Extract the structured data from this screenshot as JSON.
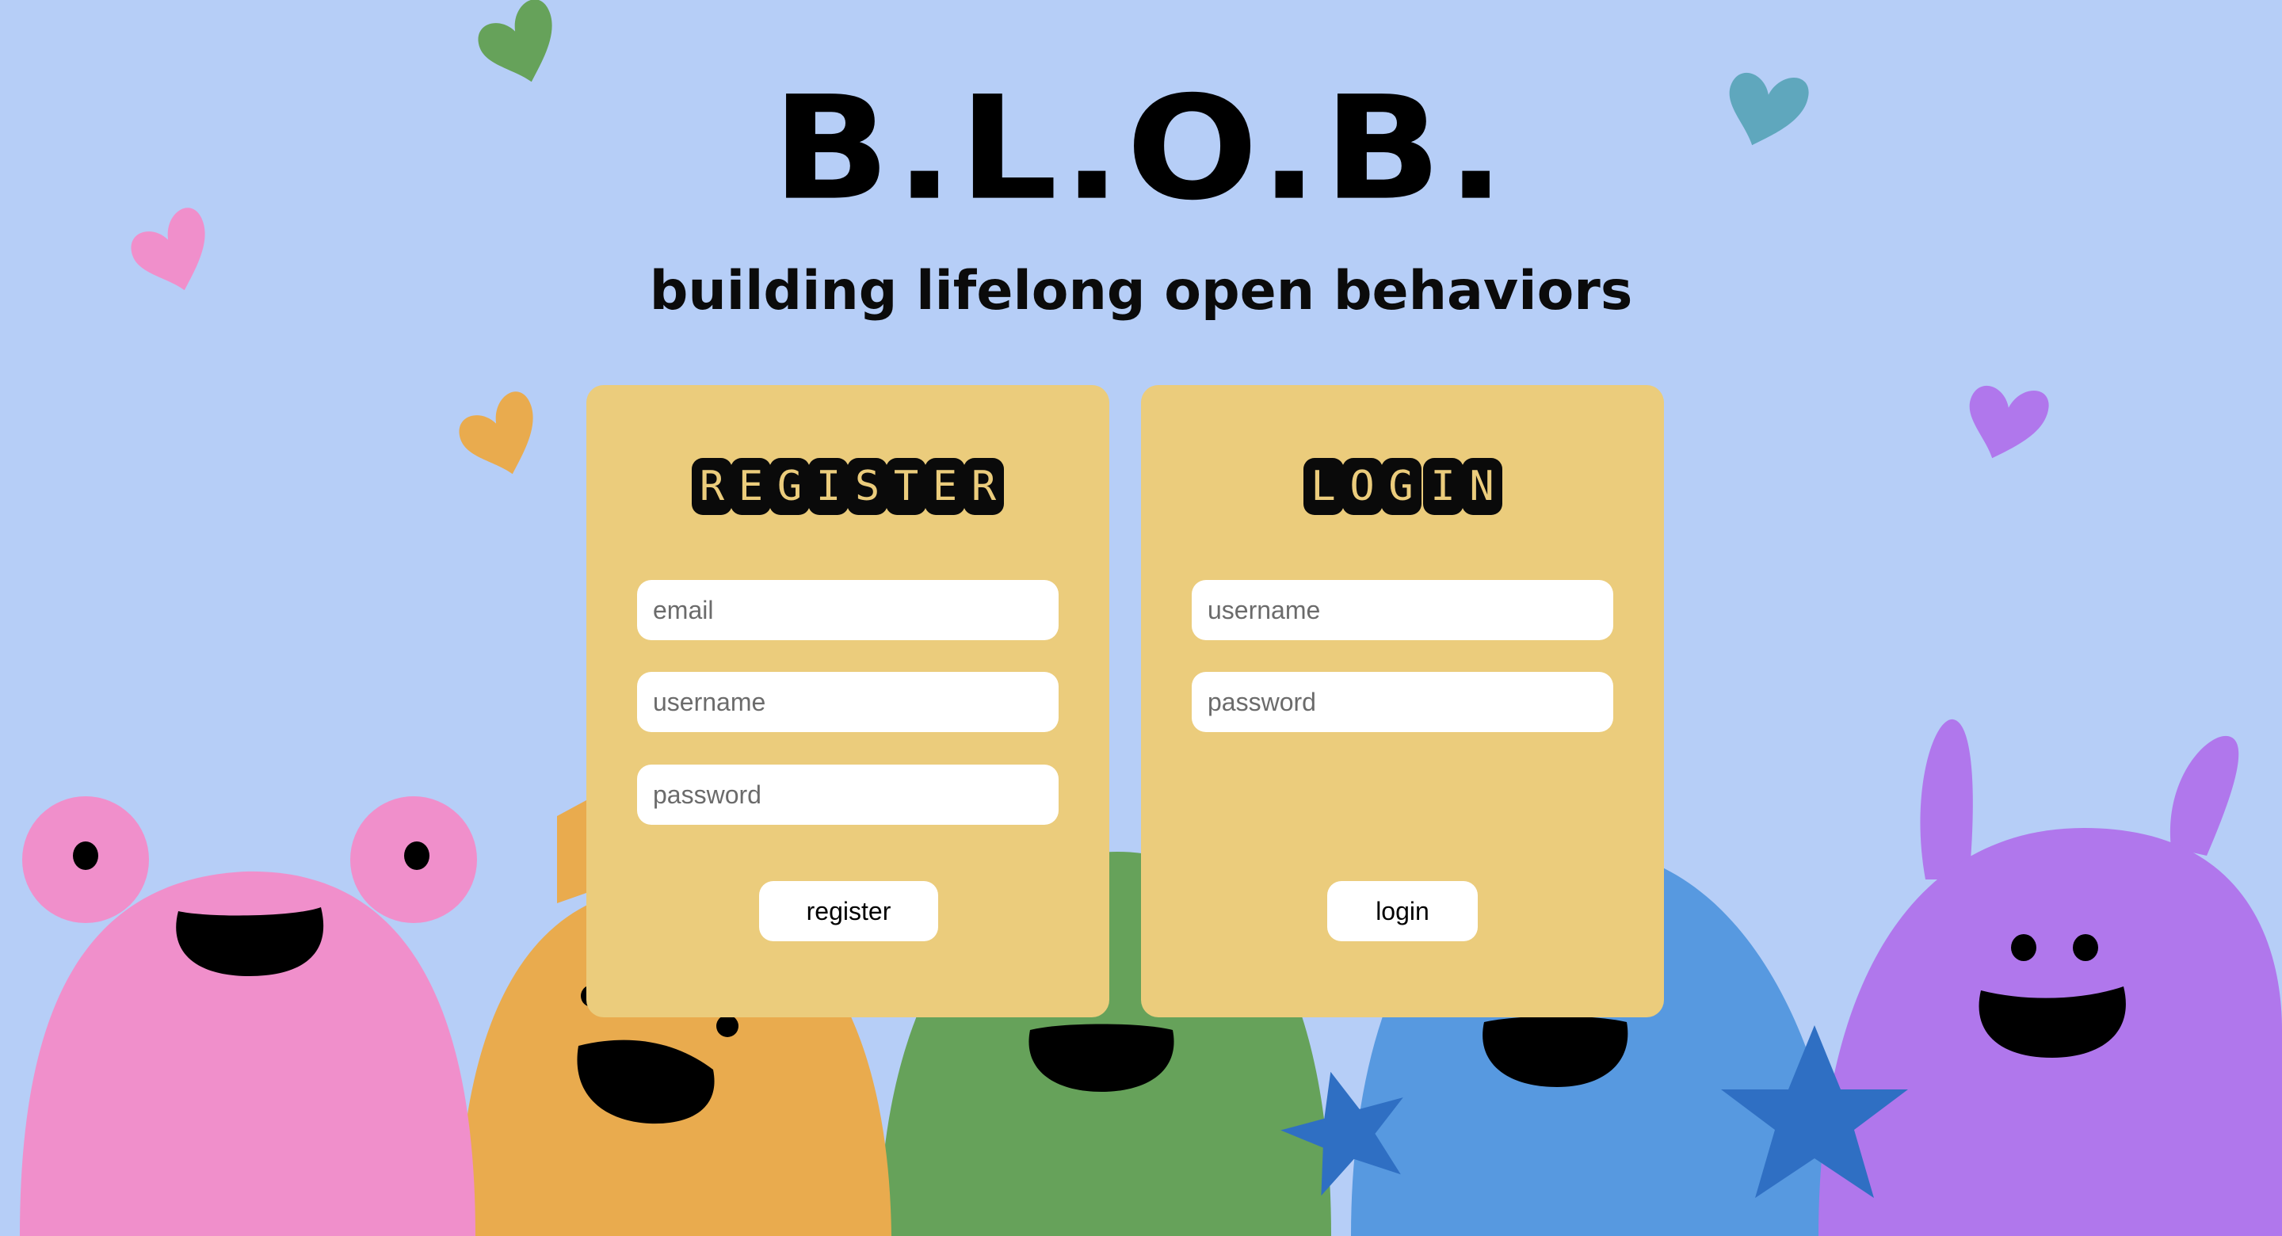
{
  "app": {
    "title": "B.L.O.B.",
    "subtitle": "building lifelong open behaviors"
  },
  "register": {
    "heading": [
      "R",
      "E",
      "G",
      "I",
      "S",
      "T",
      "E",
      "R"
    ],
    "email_placeholder": "email",
    "username_placeholder": "username",
    "password_placeholder": "password",
    "button_label": "register"
  },
  "login": {
    "heading": [
      "L",
      "O",
      "G",
      "",
      "I",
      "N"
    ],
    "username_placeholder": "username",
    "password_placeholder": "password",
    "button_label": "login"
  },
  "colors": {
    "background": "#b6cef7",
    "card": "#ebcc7c",
    "pink_blob": "#f08fcb",
    "orange_blob": "#e9ab4e",
    "green_blob": "#66a25a",
    "blue_blob": "#5799e0",
    "purple_blob": "#b077ec",
    "star": "#2f6fc3"
  },
  "icons": [
    "heart-icon",
    "star-icon",
    "blob-character"
  ]
}
